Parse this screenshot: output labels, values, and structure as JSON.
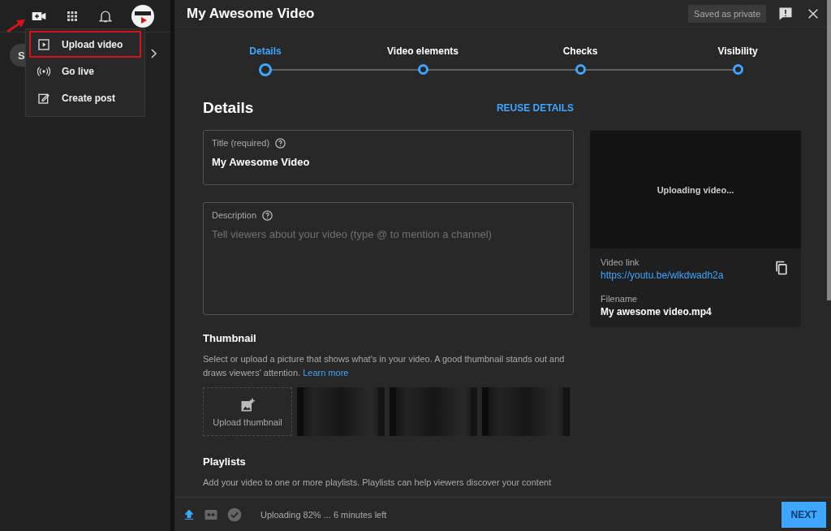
{
  "sidebar": {
    "chip": "S",
    "menu": [
      {
        "kind": "upload",
        "label": "Upload video",
        "highlighted": true
      },
      {
        "kind": "live",
        "label": "Go live",
        "highlighted": false
      },
      {
        "kind": "post",
        "label": "Create post",
        "highlighted": false
      }
    ]
  },
  "dialog": {
    "title": "My Awesome Video",
    "saved_badge": "Saved as private",
    "steps": [
      {
        "label": "Details",
        "selected": true
      },
      {
        "label": "Video elements",
        "selected": false
      },
      {
        "label": "Checks",
        "selected": false
      },
      {
        "label": "Visibility",
        "selected": false
      }
    ],
    "section_title": "Details",
    "reuse_button": "REUSE DETAILS",
    "title_field": {
      "label": "Title (required)",
      "value": "My Awesome Video"
    },
    "description_field": {
      "label": "Description",
      "placeholder": "Tell viewers about your video (type @ to mention a channel)"
    },
    "thumbnail": {
      "heading": "Thumbnail",
      "text": "Select or upload a picture that shows what's in your video. A good thumbnail stands out and draws viewers' attention.",
      "link": "Learn more",
      "upload_label": "Upload thumbnail"
    },
    "playlists": {
      "heading": "Playlists",
      "text": "Add your video to one or more playlists. Playlists can help viewers discover your content"
    },
    "preview": {
      "status": "Uploading video...",
      "link_label": "Video link",
      "link": "https://youtu.be/wlkdwadh2a",
      "filename_label": "Filename",
      "filename": "My awesome video.mp4"
    },
    "footer": {
      "status": "Uploading 82% ... 6 minutes left",
      "next_button": "NEXT"
    }
  }
}
